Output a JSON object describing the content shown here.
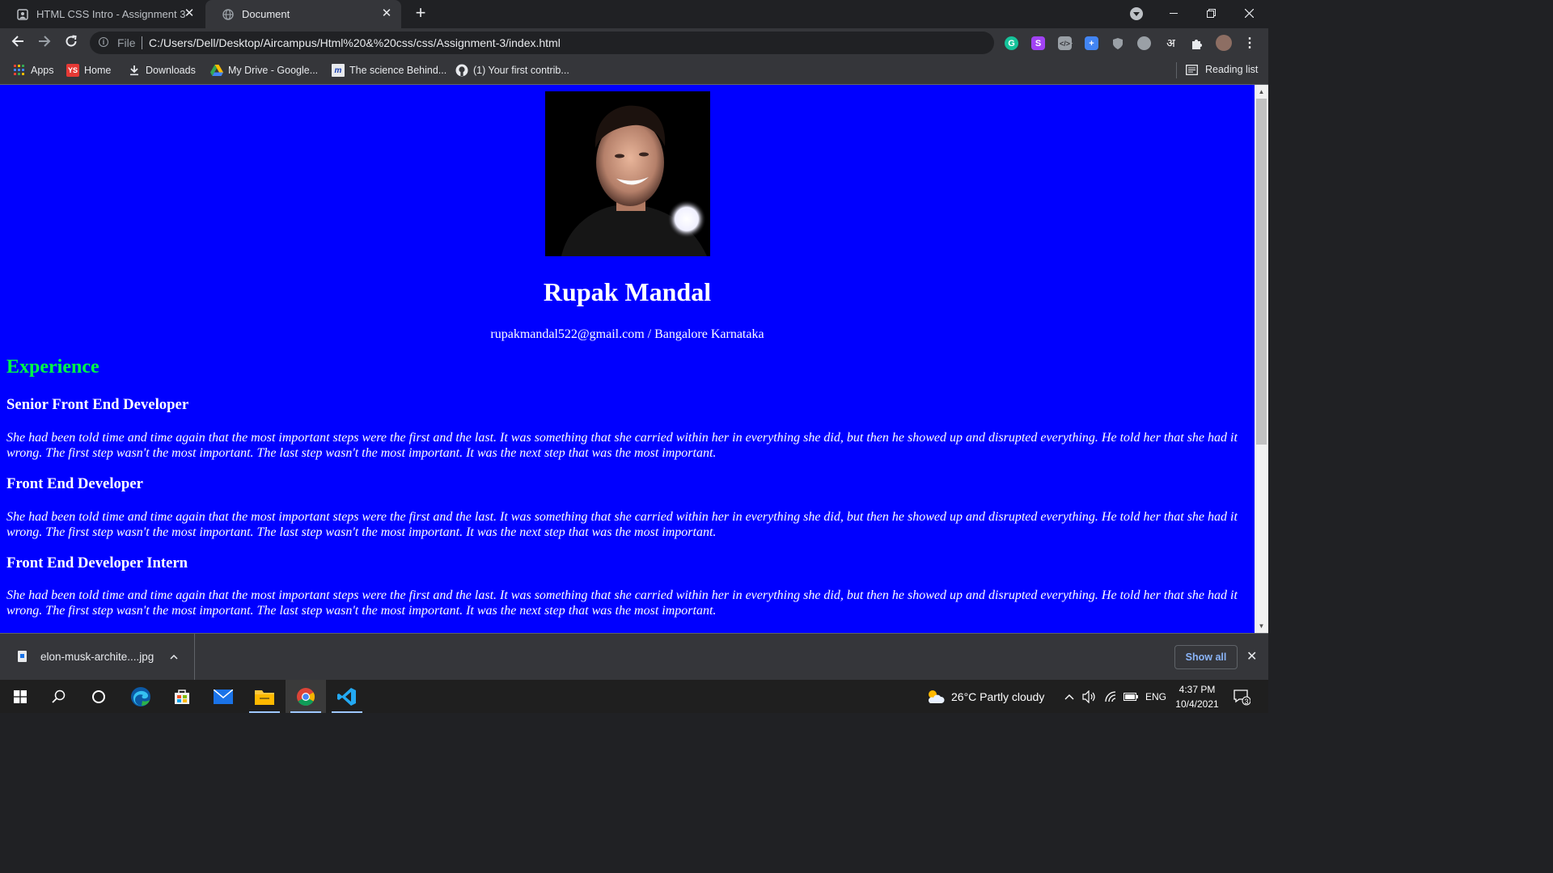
{
  "browser": {
    "tabs": [
      {
        "title": "HTML CSS Intro - Assignment 3",
        "active": false
      },
      {
        "title": "Document",
        "active": true
      }
    ],
    "address": {
      "scheme_label": "File",
      "url": "C:/Users/Dell/Desktop/Aircampus/Html%20&%20css/css/Assignment-3/index.html"
    },
    "extensions": [
      "grammarly-icon",
      "s-extension-icon",
      "code-extension-icon",
      "translate-extension-icon",
      "shield-extension-icon",
      "circle-extension-icon",
      "hindi-input-icon",
      "puzzle-icon",
      "profile-avatar"
    ],
    "extension_text": {
      "s": "S",
      "hindi": "अ"
    },
    "bookmarks": [
      {
        "label": "Apps",
        "icon": "apps-grid-icon"
      },
      {
        "label": "Home",
        "icon": "ys-icon"
      },
      {
        "label": "Downloads",
        "icon": "download-icon"
      },
      {
        "label": "My Drive - Google...",
        "icon": "google-drive-icon"
      },
      {
        "label": "The science Behind...",
        "icon": "site-icon"
      },
      {
        "label": "(1) Your first contrib...",
        "icon": "github-icon"
      }
    ],
    "bookmark_icon_text": {
      "ys": "YS",
      "site": "m"
    },
    "reading_list": "Reading list"
  },
  "page": {
    "name": "Rupak Mandal",
    "contact": "rupakmandal522@gmail.com / Bangalore Karnataka",
    "experience_heading": "Experience",
    "jobs": [
      {
        "title": "Senior Front End Developer",
        "description": "She had been told time and time again that the most important steps were the first and the last. It was something that she carried within her in everything she did, but then he showed up and disrupted everything. He told her that she had it wrong. The first step wasn't the most important. The last step wasn't the most important. It was the next step that was the most important."
      },
      {
        "title": "Front End Developer",
        "description": "She had been told time and time again that the most important steps were the first and the last. It was something that she carried within her in everything she did, but then he showed up and disrupted everything. He told her that she had it wrong. The first step wasn't the most important. The last step wasn't the most important. It was the next step that was the most important."
      },
      {
        "title": "Front End Developer Intern",
        "description": "She had been told time and time again that the most important steps were the first and the last. It was something that she carried within her in everything she did, but then he showed up and disrupted everything. He told her that she had it wrong. The first step wasn't the most important. The last step wasn't the most important. It was the next step that was the most important."
      }
    ],
    "colors": {
      "background": "#0000ff",
      "experience_heading": "#00ff44",
      "text": "#ffffff"
    }
  },
  "downloads": {
    "file_name": "elon-musk-archite....jpg",
    "show_all_label": "Show all"
  },
  "taskbar": {
    "weather": "26°C  Partly cloudy",
    "language": "ENG",
    "time": "4:37 PM",
    "date": "10/4/2021",
    "notification_count": "3"
  }
}
